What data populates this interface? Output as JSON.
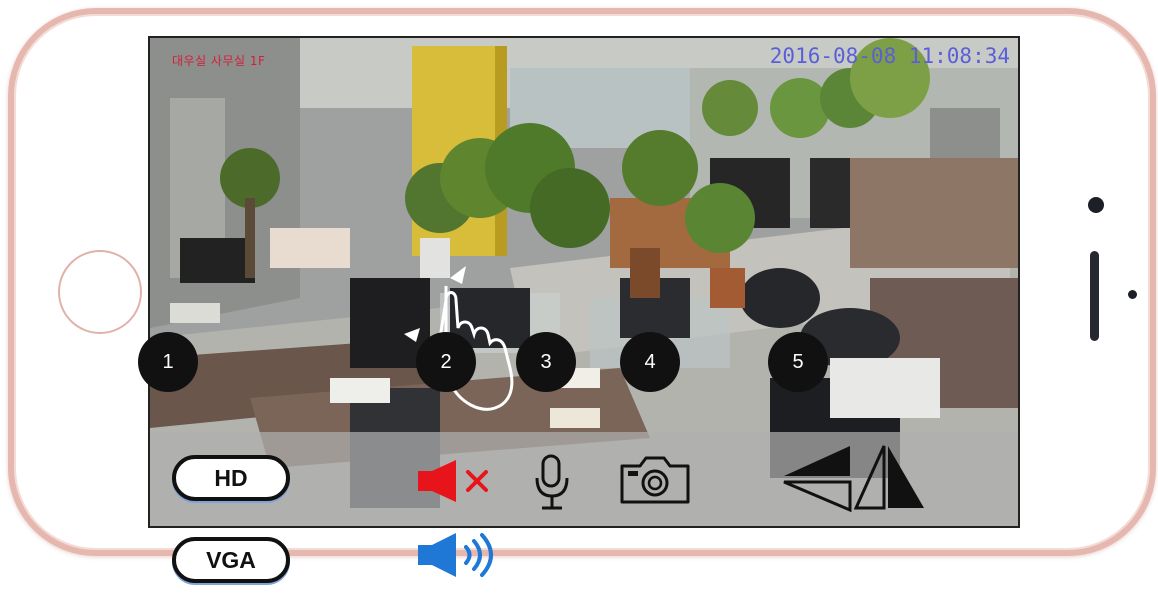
{
  "camera_feed": {
    "osd_camera_name": "대우실 사무실 1F",
    "osd_timestamp": "2016-08-08 11:08:34"
  },
  "callouts": [
    "1",
    "2",
    "3",
    "4",
    "5"
  ],
  "toolbar": {
    "quality_selected": "HD",
    "quality_alternative": "VGA",
    "icons": [
      "speaker-muted-icon",
      "microphone-icon",
      "camera-snapshot-icon",
      "flip-mirror-icon"
    ]
  },
  "alternate_states": {
    "audio_on_icon": "speaker-on-icon"
  },
  "colors": {
    "phone_frame": "#e6b7ae",
    "mute_red": "#e8141c",
    "speaker_blue": "#1f78d6",
    "pill_shadow": "#7fa3d6"
  }
}
